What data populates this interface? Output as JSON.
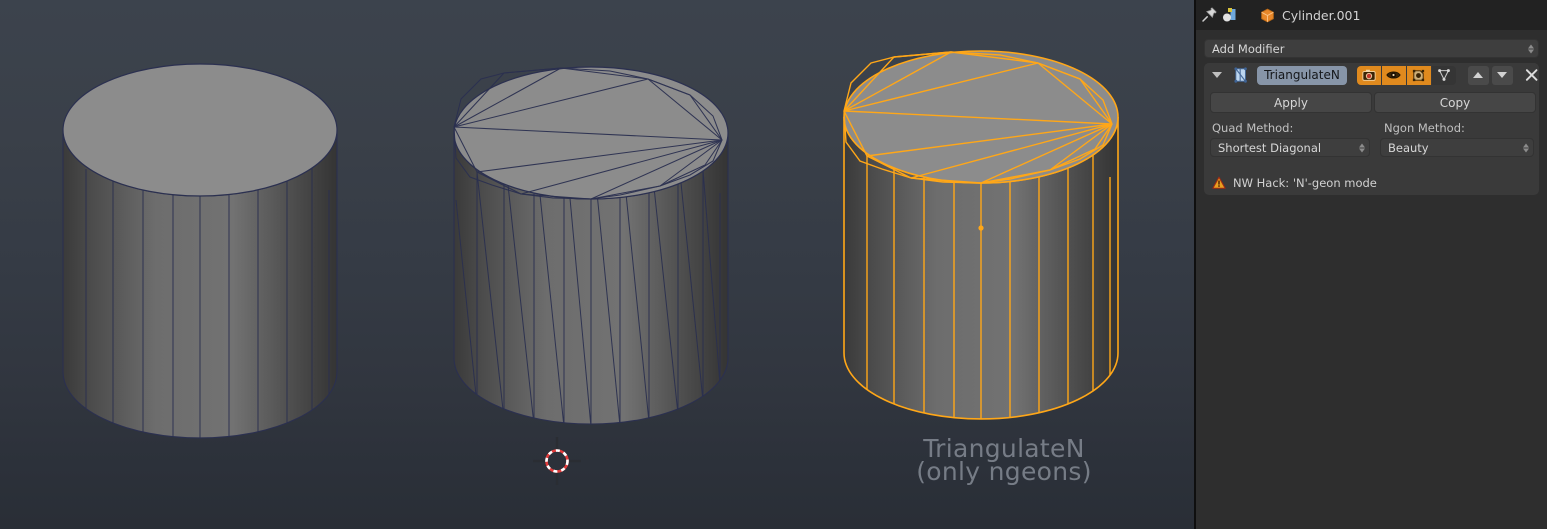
{
  "app": "Blender",
  "viewport": {
    "annotation_line1": "TriangulateN",
    "annotation_line2": "(only ngeons)",
    "cursor_name": "3d-cursor",
    "background_top": "#3c434d",
    "background_bottom": "#292e36",
    "select_color": "#FFA718",
    "mesh_fill_light": "#8c8c8c",
    "mesh_fill_mid": "#6e6e6e",
    "mesh_fill_dark": "#3b3b3b",
    "wire_color": "#2b3050",
    "objects": [
      {
        "name": "cylinder-ngon",
        "label": "untriangulated cylinder",
        "selected": false
      },
      {
        "name": "cylinder-triangulated-all",
        "label": "fully triangulated cylinder",
        "selected": false
      },
      {
        "name": "cylinder-triangulated-ngon-only",
        "label": "ngon-only triangulated cylinder",
        "selected": true
      }
    ]
  },
  "properties": {
    "header": {
      "pin_icon": "pin-icon",
      "breadcrumb_icon": "editor-type-icon",
      "object_icon": "mesh-object-icon",
      "object_name": "Cylinder.001"
    },
    "add_modifier": {
      "label": "Add Modifier"
    },
    "modifier": {
      "expand_icon": "chevron-down-icon",
      "type_icon": "triangulate-modifier-icon",
      "name": "TriangulateN",
      "toggles": [
        {
          "name": "render-toggle-icon",
          "icon": "camera-icon",
          "active": true
        },
        {
          "name": "realtime-toggle-icon",
          "icon": "eye-icon",
          "active": true
        },
        {
          "name": "edit-mode-toggle-icon",
          "icon": "editmode-icon",
          "active": true
        },
        {
          "name": "on-cage-toggle-icon",
          "icon": "vertex-icon",
          "active": false
        }
      ],
      "move_up_icon": "triangle-up-icon",
      "move_down_icon": "triangle-down-icon",
      "delete_icon": "x-icon",
      "apply_label": "Apply",
      "copy_label": "Copy",
      "quad_method_label": "Quad Method:",
      "quad_method_value": "Shortest Diagonal",
      "ngon_method_label": "Ngon Method:",
      "ngon_method_value": "Beauty",
      "warning_icon": "warning-triangle-icon",
      "warning_text": "NW Hack: 'N'-geon mode"
    }
  }
}
